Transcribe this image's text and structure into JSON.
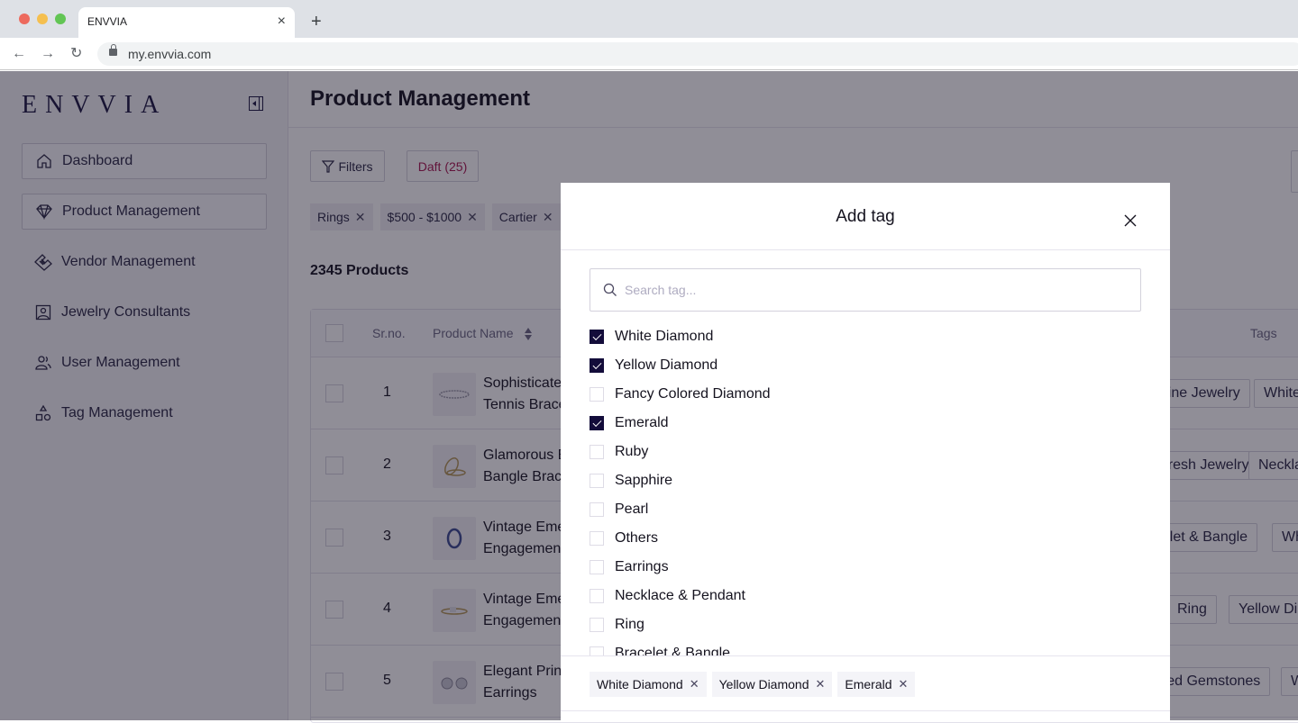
{
  "browser": {
    "tab_title": "ENVVIA",
    "tab_close": "×",
    "new_tab": "+",
    "url": "my.envvia.com",
    "back": "←",
    "forward": "→",
    "reload": "↻"
  },
  "sidebar": {
    "logo": "ENVVIA",
    "items": [
      {
        "label": "Dashboard",
        "icon": "home-icon"
      },
      {
        "label": "Product Management",
        "icon": "diamond-icon"
      },
      {
        "label": "Vendor Management",
        "icon": "handshake-icon"
      },
      {
        "label": "Jewelry Consultants",
        "icon": "consultant-icon"
      },
      {
        "label": "User Management",
        "icon": "users-icon"
      },
      {
        "label": "Tag Management",
        "icon": "shapes-icon"
      }
    ]
  },
  "page": {
    "title": "Product Management",
    "filters_label": "Filters",
    "draft_label": "Daft (25)",
    "draft_color": "#a8164f",
    "active_filters": [
      "Rings",
      "$500 - $1000",
      "Cartier"
    ],
    "product_count": "2345 Products"
  },
  "table": {
    "headers": {
      "sr": "Sr.no.",
      "name": "Product Name",
      "tags": "Tags"
    },
    "rows": [
      {
        "sr": "1",
        "name_line1": "Sophisticated",
        "name_line2": "Tennis Bracelet",
        "tags": [
          "Fine Jewelry",
          "White Diamond"
        ]
      },
      {
        "sr": "2",
        "name_line1": "Glamorous Bangle",
        "name_line2": "Bangle Bracelet",
        "tags": [
          "Fresh Jewelry",
          "Necklace"
        ]
      },
      {
        "sr": "3",
        "name_line1": "Vintage Emerald",
        "name_line2": "Engagement",
        "tags": [
          "Bracelet & Bangle",
          "White"
        ]
      },
      {
        "sr": "4",
        "name_line1": "Vintage Emerald",
        "name_line2": "Engagement",
        "tags": [
          "Ring",
          "Yellow Diamond"
        ]
      },
      {
        "sr": "5",
        "name_line1": "Elegant Princess",
        "name_line2": "Earrings",
        "tags": [
          "Colored Gemstones",
          "White"
        ]
      }
    ]
  },
  "modal": {
    "title": "Add tag",
    "search_placeholder": "Search tag...",
    "search_value": "",
    "tags": [
      {
        "label": "White Diamond",
        "checked": true
      },
      {
        "label": "Yellow Diamond",
        "checked": true
      },
      {
        "label": "Fancy Colored Diamond",
        "checked": false
      },
      {
        "label": "Emerald",
        "checked": true
      },
      {
        "label": "Ruby",
        "checked": false
      },
      {
        "label": "Sapphire",
        "checked": false
      },
      {
        "label": "Pearl",
        "checked": false
      },
      {
        "label": "Others",
        "checked": false
      },
      {
        "label": "Earrings",
        "checked": false
      },
      {
        "label": "Necklace & Pendant",
        "checked": false
      },
      {
        "label": "Ring",
        "checked": false
      },
      {
        "label": "Bracelet & Bangle",
        "checked": false
      }
    ],
    "selected": [
      "White Diamond",
      "Yellow Diamond",
      "Emerald"
    ],
    "accent_color": "#130c3a"
  }
}
